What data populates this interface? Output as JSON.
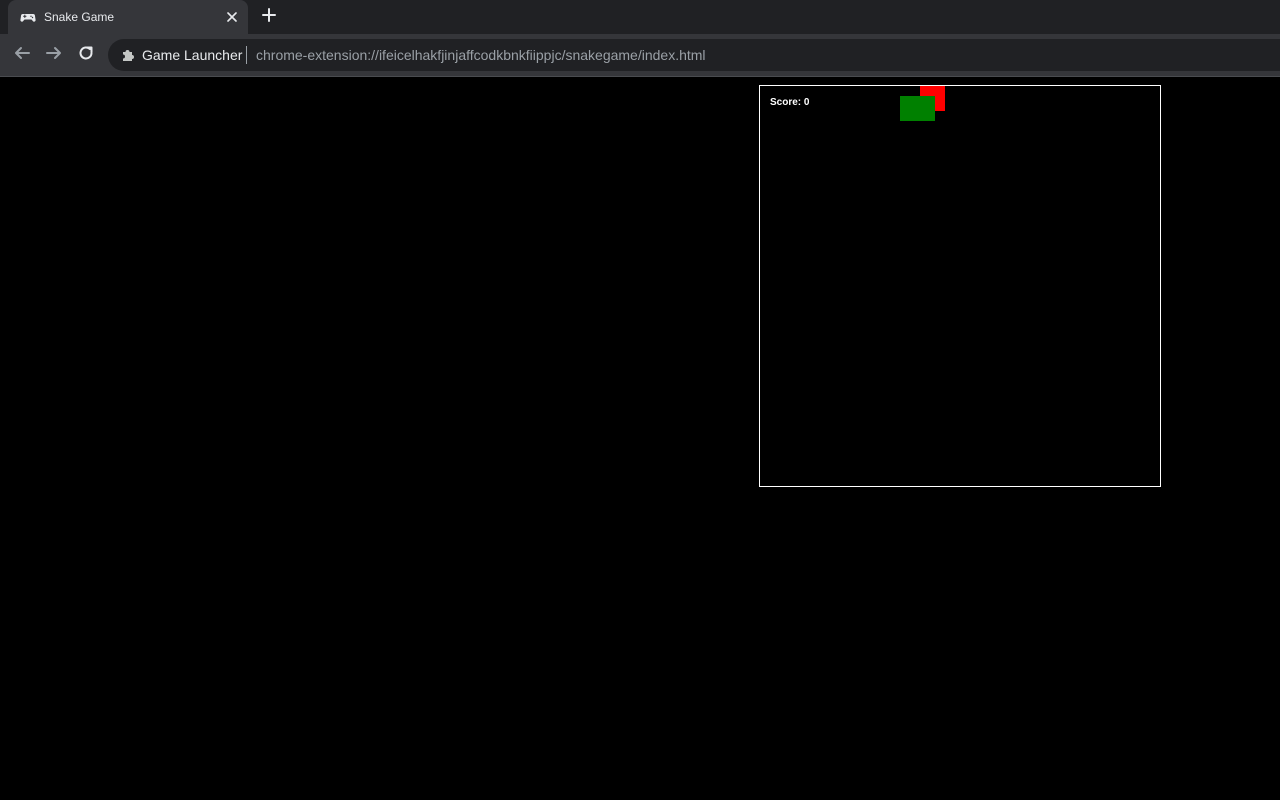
{
  "browser": {
    "tab": {
      "title": "Snake Game",
      "favicon": "gamepad-icon"
    },
    "toolbar": {
      "back_icon": "arrow-left-icon",
      "forward_icon": "arrow-right-icon",
      "reload_icon": "reload-icon",
      "origin_icon": "puzzle-icon",
      "origin_label": "Game Launcher",
      "url": "chrome-extension://ifeicelhakfjinjaffcodkbnkfiippjc/snakegame/index.html"
    }
  },
  "game": {
    "score_text": "Score: 0",
    "colors": {
      "snake": "#008000",
      "food": "#ff0000",
      "board_border": "#ffffff",
      "background": "#000000"
    }
  }
}
